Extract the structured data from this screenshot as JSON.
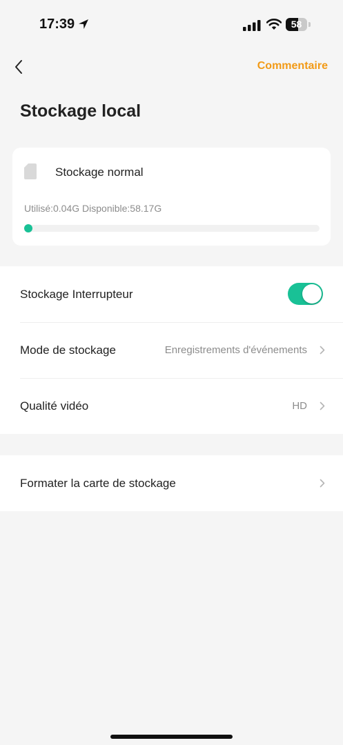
{
  "status_bar": {
    "time": "17:39",
    "battery_level": "58",
    "battery_fraction": 0.58
  },
  "header": {
    "back_icon": "chevron-left-icon",
    "comment_label": "Commentaire",
    "title": "Stockage local"
  },
  "storage": {
    "icon": "sd-card-icon",
    "status": "Stockage normal",
    "usage": "Utilisé:0.04G Disponible:58.17G",
    "used_fraction": 0.0007
  },
  "settings": {
    "storage_switch": {
      "label": "Stockage Interrupteur",
      "enabled": true
    },
    "storage_mode": {
      "label": "Mode de stockage",
      "value": "Enregistrements d'événements"
    },
    "video_quality": {
      "label": "Qualité vidéo",
      "value": "HD"
    },
    "format_card": {
      "label": "Formater la carte de stockage"
    }
  },
  "colors": {
    "accent": "#19c196",
    "comment": "#f29a16",
    "background": "#f5f5f5"
  }
}
